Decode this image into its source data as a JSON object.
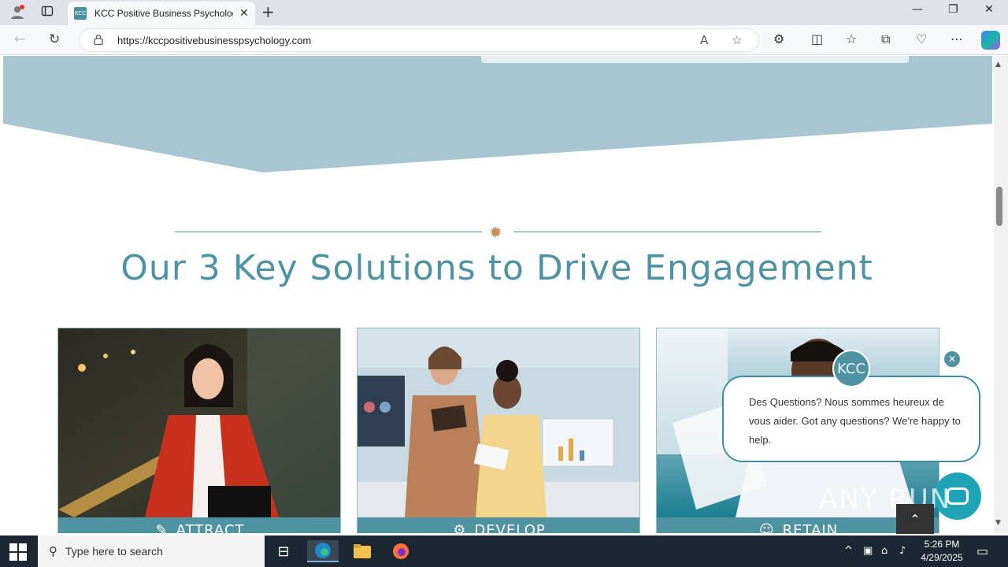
{
  "browser": {
    "tab_title": "KCC Positive Business Psychology",
    "favicon_text": "KCC",
    "url": "https://kccpositivebusinesspsychology.com",
    "new_tab_symbol": "+"
  },
  "page": {
    "heading": "Our 3 Key Solutions to Drive Engagement",
    "cards": [
      {
        "label": "ATTRACT",
        "icon": "magnet-icon"
      },
      {
        "label": "DEVELOP",
        "icon": "gears-icon"
      },
      {
        "label": "RETAIN",
        "icon": "smile-icon"
      }
    ],
    "colors": {
      "band": "#a7c6d1",
      "accent": "#4f93a2",
      "ornament": "#c58f5d"
    }
  },
  "chat": {
    "avatar_text": "KCC",
    "message": "Des Questions? Nous sommes heureux de vous aider. Got any questions? We're happy to help."
  },
  "watermark": "ANY RUN",
  "taskbar": {
    "search_placeholder": "Type here to search",
    "time": "5:26 PM",
    "date": "4/29/2025"
  }
}
